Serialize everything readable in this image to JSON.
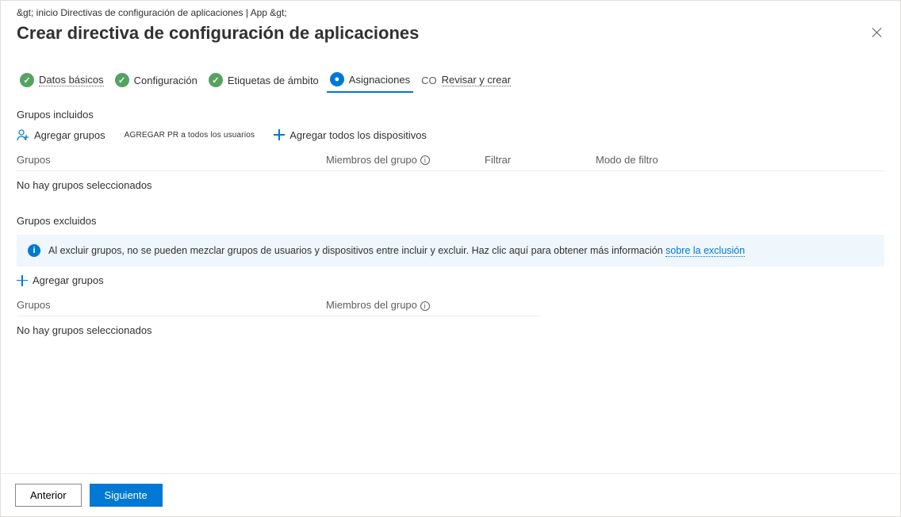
{
  "breadcrumb": "&gt; inicio   Directivas de configuración de aplicaciones | App &gt;",
  "title": "Crear directiva de configuración de aplicaciones",
  "steps": {
    "s1": "Datos básicos",
    "s2": "Configuración",
    "s3": "Etiquetas de ámbito",
    "s4": "Asignaciones",
    "s5_badge": "CO",
    "s5": "Revisar y crear"
  },
  "included": {
    "heading": "Grupos incluidos",
    "add_groups": "Agregar grupos",
    "add_all_users": "AGREGAR PR a todos los usuarios",
    "add_all_devices": "Agregar todos los dispositivos",
    "cols": {
      "groups": "Grupos",
      "members": "Miembros del grupo",
      "filter": "Filtrar",
      "filter_mode": "Modo de filtro"
    },
    "empty": "No hay grupos seleccionados"
  },
  "excluded": {
    "heading": "Grupos excluidos",
    "info_text": "Al excluir grupos, no se pueden mezclar grupos de usuarios y dispositivos entre incluir y excluir. Haz clic aquí para obtener más información ",
    "info_link": "sobre la exclusión",
    "add_groups": "Agregar grupos",
    "cols": {
      "groups": "Grupos",
      "members": "Miembros del grupo"
    },
    "empty": "No hay grupos seleccionados"
  },
  "footer": {
    "prev": "Anterior",
    "next": "Siguiente"
  }
}
